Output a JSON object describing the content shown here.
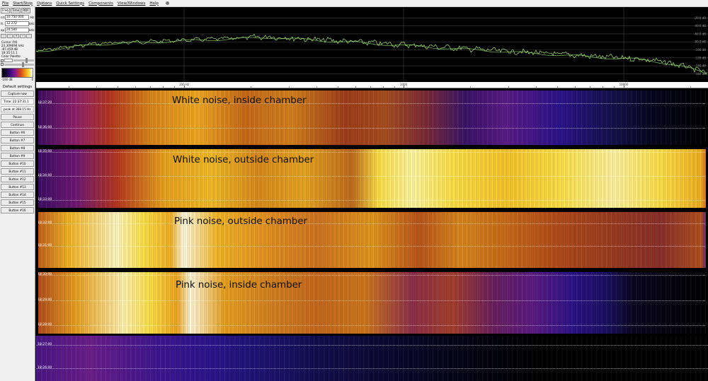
{
  "menu": [
    "File",
    "Start/Stop",
    "Options",
    "Quick Settings",
    "Components",
    "View/Windows",
    "Help"
  ],
  "sidebar": {
    "tabs": [
      "Freq",
      "Time",
      "RDF"
    ],
    "fields": [
      {
        "label": "c/s",
        "value": "10.750 000",
        "unit": "Hz"
      },
      {
        "label": "fs",
        "value": "12.272",
        "unit": "kHz"
      },
      {
        "label": "ap",
        "value": "24.500",
        "unit": "kHz"
      }
    ],
    "cursor_title": "Cursor (fd)",
    "cursor_freq": "23.309094 kHz",
    "cursor_level": "-87.459 dB",
    "cursor_time": "18:35:11.1",
    "palette_title": "Color Palette",
    "palette_min": "-100 dB",
    "palette_max": "0",
    "default_settings": "Default settings",
    "capture_button": "Capture now",
    "time_label": "Time: 22:37:31.1",
    "peak_label": "peak at 368.15 Hz",
    "buttons": [
      "Pause",
      "Continue",
      "Button #6",
      "Button #7",
      "Button #8",
      "Button #9",
      "Button #10",
      "Button #11",
      "Button #12",
      "Button #13",
      "Button #14",
      "Button #15",
      "Button #16"
    ]
  },
  "spectrum": {
    "db_labels": [
      "-20.0 dB",
      "-40.0 dB",
      "-60.0 dB",
      "-80.0 dB",
      "-100 dB",
      "-120 dB",
      "-140 dB",
      "-160 dB"
    ],
    "freq_labels": [
      "100 Hz",
      "1000",
      "10000"
    ]
  },
  "bands": [
    {
      "title": "White noise, inside chamber",
      "times": [
        "18:37:20",
        "18:36:00"
      ]
    },
    {
      "title": "White noise, outside chamber",
      "times": [
        "18:35:00",
        "18:34:00",
        "18:33:00"
      ]
    },
    {
      "title": "Pink noise, outside chamber",
      "times": [
        "18:32:00",
        "18:31:00"
      ]
    },
    {
      "title": "Pink noise, inside chamber",
      "times": [
        "18:30:00",
        "18:29:00",
        "18:28:00"
      ]
    },
    {
      "title": "",
      "times": [
        "18:27:00",
        "18:26:00"
      ]
    }
  ],
  "colors": {
    "palette": [
      "#000000",
      "#1a0838",
      "#48108a",
      "#8d1c8a",
      "#d94a1c",
      "#f6a21e",
      "#fde047",
      "#ffffff"
    ],
    "trace": "#a8e07a",
    "grid": "#404040"
  }
}
